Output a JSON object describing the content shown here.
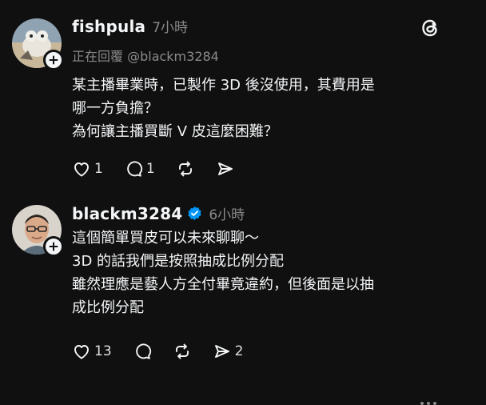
{
  "post1": {
    "username": "fishpula",
    "time": "7小時",
    "replying_to": "正在回覆 @blackm3284",
    "lines": [
      "某主播畢業時，已製作 3D 後沒使用，其費用是",
      "哪一方負擔？",
      "為何讓主播買斷 V 皮這麼困難？"
    ],
    "likes": "1",
    "replies": "1",
    "reposts": "",
    "shares": ""
  },
  "post2": {
    "username": "blackm3284",
    "time": "6小時",
    "lines": [
      "這個簡單買皮可以未來聊聊～",
      "3D 的話我們是按照抽成比例分配",
      "雖然理應是藝人方全付畢竟違約，但後面是以抽",
      "成比例分配"
    ],
    "likes": "13",
    "replies": "",
    "reposts": "",
    "shares": "2"
  },
  "icons": {
    "like": "heart-icon",
    "reply": "comment-icon",
    "repost": "repost-icon",
    "share": "send-icon",
    "threads": "threads-logo-icon",
    "more": "more-icon",
    "verified": "verified-badge-icon"
  },
  "colors": {
    "background": "#101010",
    "text": "#f3f5f7",
    "muted": "#8a8a8a",
    "verified": "#0095f6"
  }
}
